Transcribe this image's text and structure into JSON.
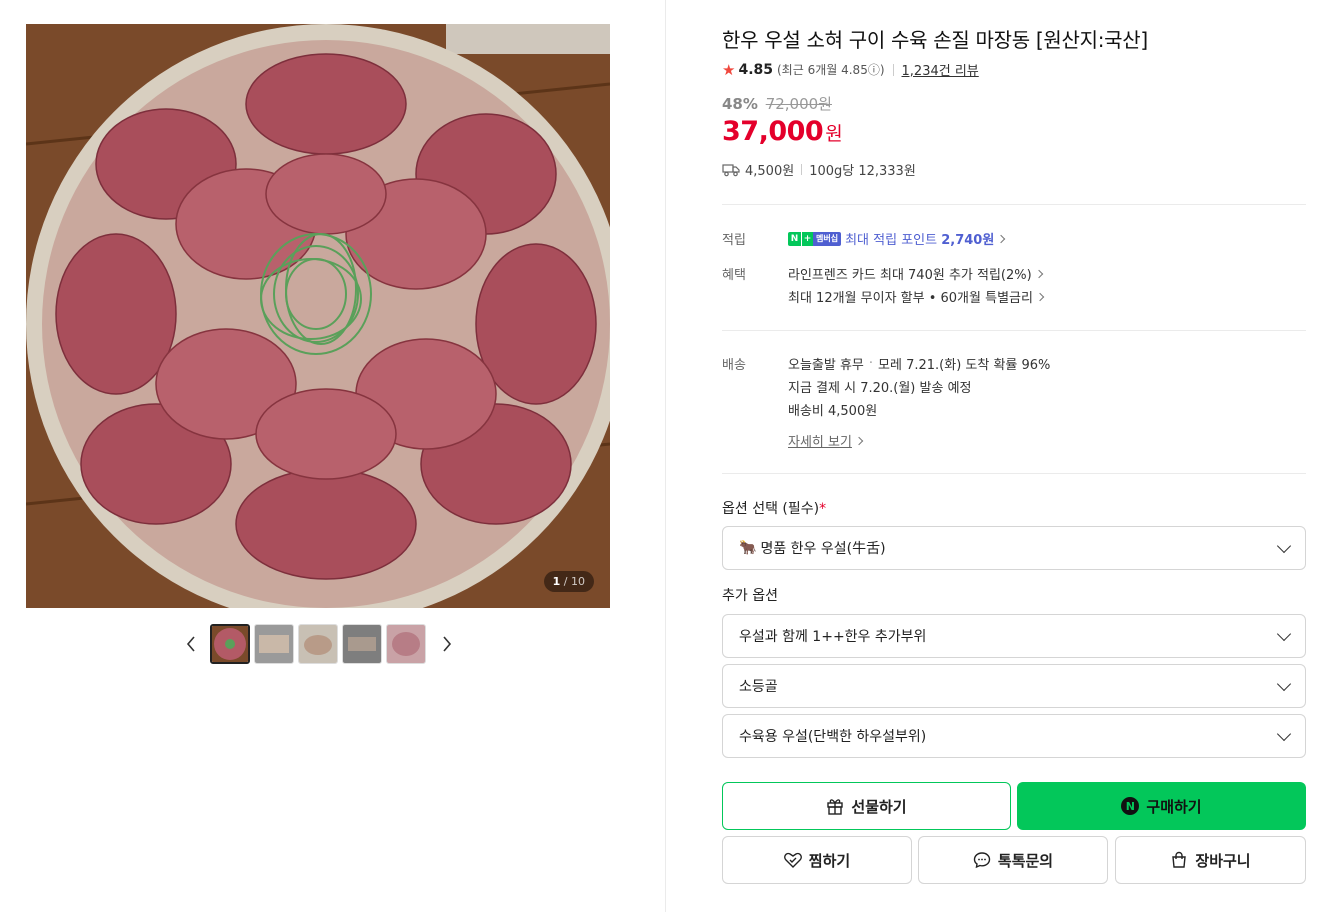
{
  "gallery": {
    "counter_current": "1",
    "counter_total": "10"
  },
  "product": {
    "title": "한우 우설 소혀 구이 수육 손질 마장동 [원산지:국산]",
    "rating": "4.85",
    "recent_rating": "(최근 6개월 4.85ⓘ)",
    "review_count": "1,234건 리뷰",
    "discount_pct": "48%",
    "original_price": "72,000원",
    "price": "37,000",
    "price_unit": "원",
    "shipping_fee": "4,500원",
    "unit_price": "100g당 12,333원"
  },
  "benefits": {
    "point_label": "적립",
    "point_badge_n": "N",
    "point_badge_plus": "+",
    "point_badge_member": "멤버십",
    "point_text": "최대 적립 포인트",
    "point_amount": "2,740원",
    "benefit_label": "혜택",
    "benefit_1": "라인프렌즈 카드 최대 740원 추가 적립(2%)",
    "benefit_2": "최대 12개월 무이자 할부 • 60개월 특별금리"
  },
  "delivery": {
    "label": "배송",
    "today": "오늘출발 휴무",
    "dot": "·",
    "arrival": "모레 7.21.(화) 도착 확률 96%",
    "dispatch": "지금 결제 시 7.20.(월) 발송 예정",
    "fee": "배송비 4,500원",
    "detail_link": "자세히 보기"
  },
  "options": {
    "required_title": "옵션 선택 (필수)",
    "required_mark": "*",
    "required_value": "명품 한우 우설(牛舌)",
    "extra_title": "추가 옵션",
    "extra_1": "우설과 함께 1++한우 추가부위",
    "extra_2": "소등골",
    "extra_3": "수육용 우설(단백한 하우설부위)"
  },
  "actions": {
    "gift": "선물하기",
    "buy": "구매하기",
    "buy_badge": "N",
    "zzim": "찜하기",
    "talk": "톡톡문의",
    "cart": "장바구니"
  },
  "colors": {
    "accent_green": "#03c75a",
    "price_red": "#e4002b",
    "point_purple": "#4f5fd1"
  }
}
